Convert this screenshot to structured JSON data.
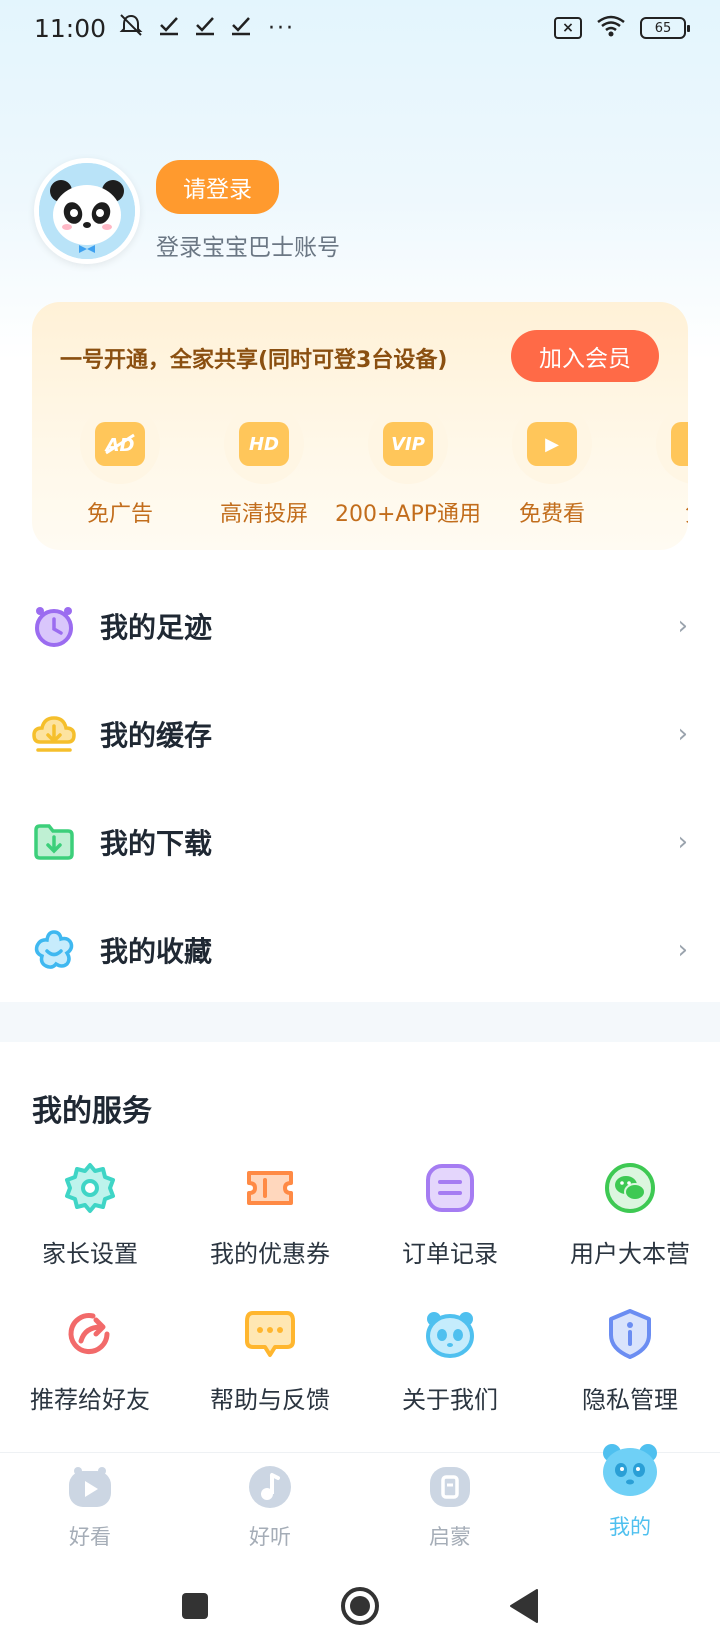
{
  "status_bar": {
    "time": "11:00",
    "dots": "···",
    "battery": "65"
  },
  "profile": {
    "login_button": "请登录",
    "subtitle": "登录宝宝巴士账号"
  },
  "vip": {
    "title": "一号开通，全家共享(同时可登3台设备)",
    "join_button": "加入会员",
    "benefits": [
      {
        "label": "免广告",
        "icon": "no-ads-icon",
        "glyph": "AD"
      },
      {
        "label": "高清投屏",
        "icon": "hd-icon",
        "glyph": "HD"
      },
      {
        "label": "200+APP通用",
        "icon": "vip-icon",
        "glyph": "VIP"
      },
      {
        "label": "免费看",
        "icon": "play-icon",
        "glyph": "▶"
      },
      {
        "label": "免",
        "icon": "partial-benefit-icon",
        "glyph": ""
      }
    ]
  },
  "menu": [
    {
      "label": "我的足迹",
      "icon": "clock-icon",
      "color": "#9b6cf0"
    },
    {
      "label": "我的缓存",
      "icon": "cache-icon",
      "color": "#f5bf2c"
    },
    {
      "label": "我的下载",
      "icon": "download-folder-icon",
      "color": "#3ccf7a"
    },
    {
      "label": "我的收藏",
      "icon": "flower-favorite-icon",
      "color": "#3fb8f0"
    }
  ],
  "services": {
    "title": "我的服务",
    "items": [
      {
        "label": "家长设置",
        "icon": "gear-icon",
        "color": "#3fd5c6"
      },
      {
        "label": "我的优惠券",
        "icon": "coupon-icon",
        "color": "#ff8a45"
      },
      {
        "label": "订单记录",
        "icon": "order-icon",
        "color": "#a57cf2"
      },
      {
        "label": "用户大本营",
        "icon": "wechat-icon",
        "color": "#3ec953"
      },
      {
        "label": "推荐给好友",
        "icon": "share-icon",
        "color": "#f26a6a"
      },
      {
        "label": "帮助与反馈",
        "icon": "feedback-icon",
        "color": "#ffb62e"
      },
      {
        "label": "关于我们",
        "icon": "panda-icon",
        "color": "#4fc0ef"
      },
      {
        "label": "隐私管理",
        "icon": "privacy-icon",
        "color": "#6b8df2"
      }
    ]
  },
  "tabs": [
    {
      "label": "好看",
      "icon": "watch-tab-icon",
      "active": false
    },
    {
      "label": "好听",
      "icon": "listen-tab-icon",
      "active": false
    },
    {
      "label": "启蒙",
      "icon": "learn-tab-icon",
      "active": false
    },
    {
      "label": "我的",
      "icon": "mine-tab-icon",
      "active": true
    }
  ]
}
